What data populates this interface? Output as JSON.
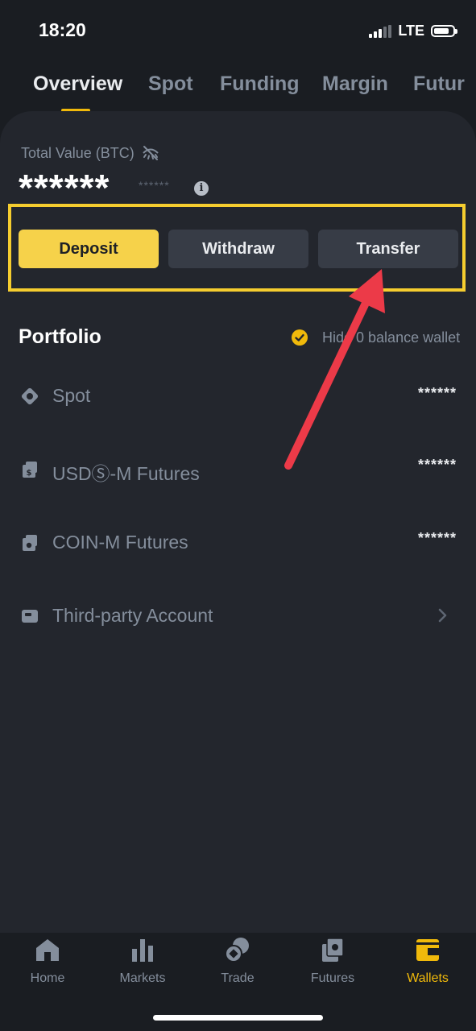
{
  "status": {
    "time": "18:20",
    "network": "LTE"
  },
  "tabs": [
    {
      "label": "Overview",
      "active": true
    },
    {
      "label": "Spot"
    },
    {
      "label": "Funding"
    },
    {
      "label": "Margin"
    },
    {
      "label": "Futur"
    }
  ],
  "overview": {
    "total_label": "Total Value (BTC)",
    "balance_masked": "******",
    "balance_small_masked": "******",
    "info_glyph": "i"
  },
  "actions": {
    "deposit": "Deposit",
    "withdraw": "Withdraw",
    "transfer": "Transfer"
  },
  "portfolio": {
    "title": "Portfolio",
    "hide_zero_label": "Hide 0 balance wallet",
    "hide_zero_checked": true,
    "items": [
      {
        "label": "Spot",
        "value": "******",
        "icon": "spot-icon"
      },
      {
        "label": "USDⓈ-M Futures",
        "value": "******",
        "icon": "usdm-futures-icon"
      },
      {
        "label": "COIN-M Futures",
        "value": "******",
        "icon": "coinm-futures-icon"
      },
      {
        "label": "Third-party Account",
        "value": "",
        "icon": "third-party-icon"
      }
    ]
  },
  "bottom_nav": [
    {
      "label": "Home",
      "icon": "home-icon"
    },
    {
      "label": "Markets",
      "icon": "markets-icon"
    },
    {
      "label": "Trade",
      "icon": "trade-icon"
    },
    {
      "label": "Futures",
      "icon": "futures-icon"
    },
    {
      "label": "Wallets",
      "icon": "wallets-icon",
      "active": true
    }
  ],
  "colors": {
    "accent": "#f0b90b",
    "background": "#1a1d22",
    "panel": "#23262d",
    "highlight_border": "#f5cd2f",
    "arrow": "#ec3a48"
  }
}
